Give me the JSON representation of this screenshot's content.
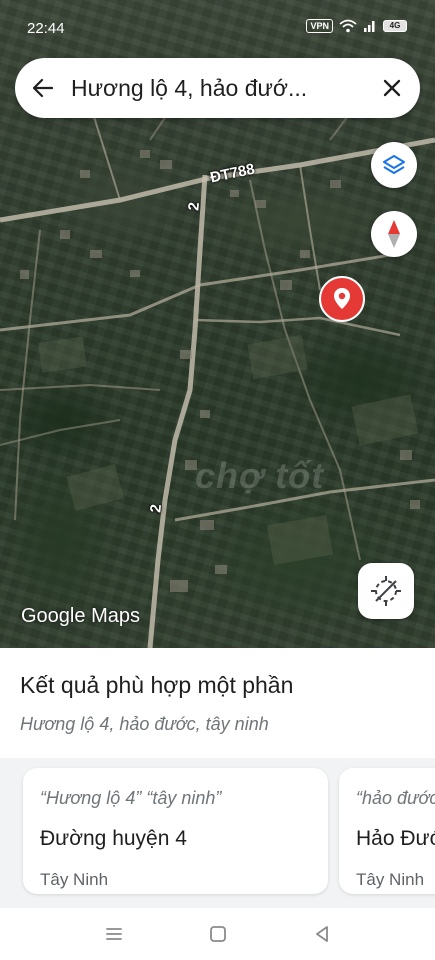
{
  "status_bar": {
    "time": "22:44",
    "vpn": "VPN",
    "battery": "4G"
  },
  "search": {
    "query": "Hương lộ 4, hảo đướ..."
  },
  "map": {
    "road_labels": {
      "dt788": "ĐT788",
      "route_2_upper": "2",
      "route_2_lower": "2"
    },
    "watermark": "chợ tốt",
    "attribution_google": "Google",
    "attribution_maps": "Maps",
    "pin_color": "#e53935"
  },
  "results": {
    "title": "Kết quả phù hợp một phần",
    "subtitle": "Hương lộ 4, hảo đước, tây ninh",
    "cards": [
      {
        "quote": "“Hương lộ 4” “tây ninh”",
        "name": "Đường huyện 4",
        "region": "Tây Ninh"
      },
      {
        "quote": "“hảo đước”",
        "name": "Hảo Đước",
        "region": "Tây Ninh"
      }
    ]
  },
  "nav": {
    "menu": "menu-icon",
    "home": "home-icon",
    "back": "back-icon"
  },
  "colors": {
    "accent_blue": "#1a73e8",
    "text_primary": "#1f1f1f",
    "text_secondary": "#70757a"
  }
}
